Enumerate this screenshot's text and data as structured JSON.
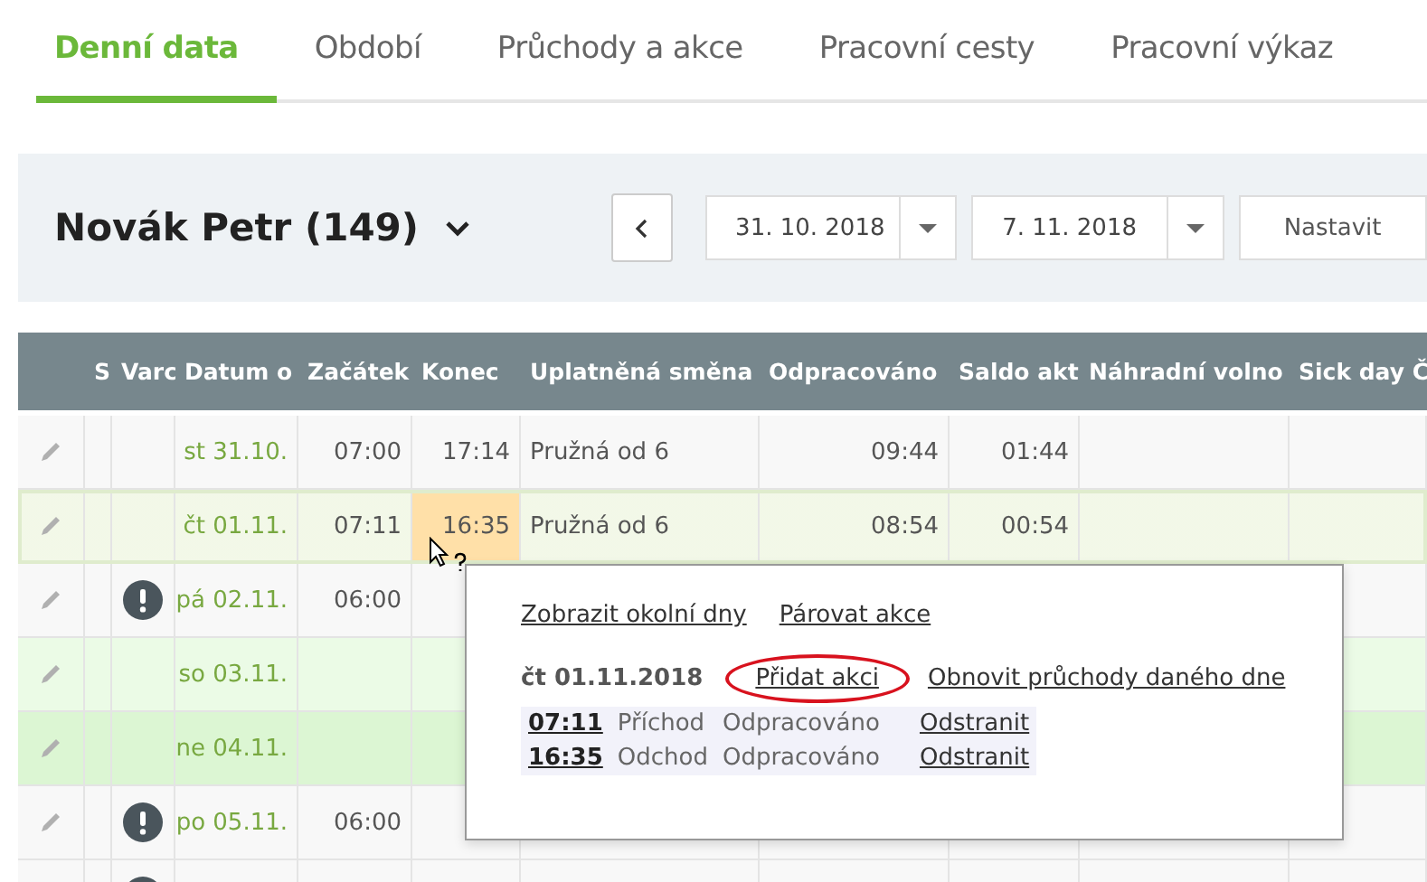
{
  "tabs": [
    {
      "label": "Denní data",
      "selected": true
    },
    {
      "label": "Období",
      "selected": false
    },
    {
      "label": "Průchody a akce",
      "selected": false
    },
    {
      "label": "Pracovní cesty",
      "selected": false
    },
    {
      "label": "Pracovní výkaz",
      "selected": false
    }
  ],
  "toolbar": {
    "person": "Novák Petr (149)",
    "date_from": "31. 10. 2018",
    "date_to": "7. 11. 2018",
    "apply_button": "Nastavit"
  },
  "table": {
    "columns": [
      "",
      "S",
      "Varc",
      "Datum o",
      "Začátek",
      "Konec",
      "Uplatněná směna",
      "Odpracováno",
      "Saldo akt",
      "Náhradní volno",
      "Sick day Č"
    ],
    "rows": [
      {
        "date": "st 31.10.",
        "start": "07:00",
        "end": "17:14",
        "shift": "Pružná od 6",
        "worked": "09:44",
        "balance": "01:44",
        "alert": false,
        "selected": false,
        "kind": "workday",
        "end_highlighted": false
      },
      {
        "date": "čt 01.11.",
        "start": "07:11",
        "end": "16:35",
        "shift": "Pružná od 6",
        "worked": "08:54",
        "balance": "00:54",
        "alert": false,
        "selected": true,
        "kind": "workday",
        "end_highlighted": true
      },
      {
        "date": "pá 02.11.",
        "start": "06:00",
        "alert": true,
        "selected": false,
        "kind": "workday",
        "end_highlighted": false
      },
      {
        "date": "so 03.11.",
        "alert": false,
        "selected": false,
        "kind": "saturday",
        "end_highlighted": false
      },
      {
        "date": "ne 04.11.",
        "alert": false,
        "selected": false,
        "kind": "sunday",
        "end_highlighted": false
      },
      {
        "date": "po 05.11.",
        "start": "06:00",
        "alert": true,
        "selected": false,
        "kind": "workday",
        "end_highlighted": false
      },
      {
        "alert": true,
        "selected": false,
        "kind": "workday",
        "end_highlighted": false
      }
    ]
  },
  "popup": {
    "top_links": [
      "Zobrazit okolní dny",
      "Párovat akce"
    ],
    "day": "čt 01.11.2018",
    "day_actions": [
      {
        "label": "Přidat akci",
        "circled": true
      },
      {
        "label": "Obnovit průchody daného dne",
        "circled": false
      }
    ],
    "events": [
      {
        "time": "07:11",
        "type": "Příchod",
        "category": "Odpracováno",
        "action": "Odstranit"
      },
      {
        "time": "16:35",
        "type": "Odchod",
        "category": "Odpracováno",
        "action": "Odstranit"
      }
    ]
  }
}
